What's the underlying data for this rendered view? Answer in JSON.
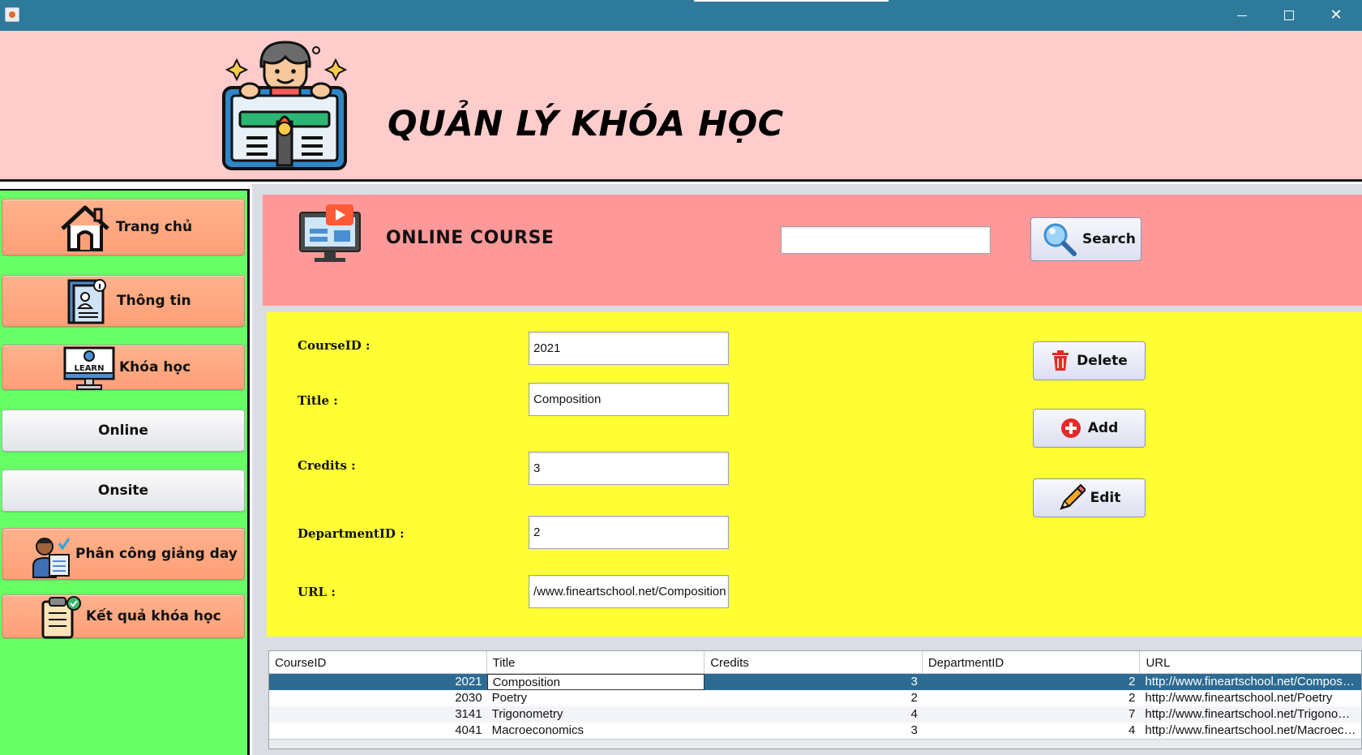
{
  "window": {
    "controls": {
      "minimize": "minimize",
      "maximize": "maximize",
      "close": "✕"
    }
  },
  "header": {
    "title": "QUẢN LÝ KHÓA HỌC",
    "logo_icon": "teacher-board-icon"
  },
  "sidebar": {
    "items": [
      {
        "label": "Trang chủ",
        "icon": "house-icon",
        "style": "orange"
      },
      {
        "label": "Thông tin",
        "icon": "profile-card-icon",
        "style": "orange"
      },
      {
        "label": "Khóa học",
        "icon": "learn-monitor-icon",
        "style": "orange"
      },
      {
        "label": "Online",
        "style": "plain"
      },
      {
        "label": "Onsite",
        "style": "plain"
      },
      {
        "label": "Phân công giảng day",
        "icon": "teacher-assignment-icon",
        "style": "orange"
      },
      {
        "label": "Kết quả khóa học",
        "icon": "clipboard-result-icon",
        "style": "orange"
      }
    ]
  },
  "banner": {
    "title": "ONLINE COURSE",
    "icon": "video-monitor-icon"
  },
  "search": {
    "value": "",
    "button_label": "Search",
    "icon": "magnifier-icon"
  },
  "form": {
    "course_id_label": "CourseID :",
    "course_id_value": "2021",
    "title_label": "Title :",
    "title_value": "Composition",
    "credits_label": "Credits :",
    "credits_value": "3",
    "department_label": "DepartmentID :",
    "department_value": "2",
    "url_label": "URL :",
    "url_value": "/www.fineartschool.net/Composition"
  },
  "actions": {
    "delete_label": "Delete",
    "add_label": "Add",
    "edit_label": "Edit"
  },
  "table": {
    "columns": [
      "CourseID",
      "Title",
      "Credits",
      "DepartmentID",
      "URL"
    ],
    "rows": [
      {
        "course_id": "2021",
        "title": "Composition",
        "credits": "3",
        "department_id": "2",
        "url": "http://www.fineartschool.net/Compositi..."
      },
      {
        "course_id": "2030",
        "title": "Poetry",
        "credits": "2",
        "department_id": "2",
        "url": "http://www.fineartschool.net/Poetry"
      },
      {
        "course_id": "3141",
        "title": "Trigonometry",
        "credits": "4",
        "department_id": "7",
        "url": "http://www.fineartschool.net/Trigonome..."
      },
      {
        "course_id": "4041",
        "title": "Macroeconomics",
        "credits": "3",
        "department_id": "4",
        "url": "http://www.fineartschool.net/Macroecon..."
      }
    ],
    "selected_row": 0
  },
  "colors": {
    "titlebar": "#2e7a9b",
    "header": "#ffcccc",
    "sidebar": "#66ff66",
    "banner": "#ff9999",
    "form": "#ffff33",
    "selected_row": "#2e6b92"
  }
}
